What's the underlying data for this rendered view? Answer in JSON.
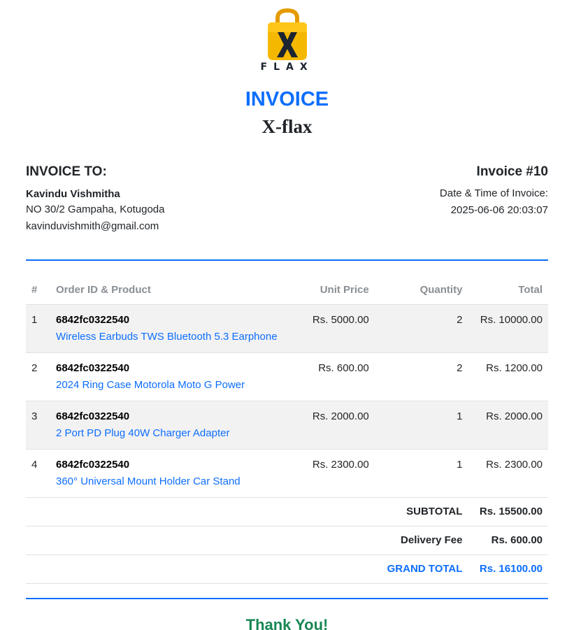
{
  "brand": {
    "logo_text": "FLAX",
    "title": "INVOICE",
    "company": "X-flax"
  },
  "bill_to": {
    "heading": "INVOICE TO:",
    "name": "Kavindu Vishmitha",
    "address": "NO 30/2 Gampaha, Kotugoda",
    "email": "kavinduvishmith@gmail.com"
  },
  "invoice": {
    "number": "Invoice #10",
    "date_label": "Date & Time of Invoice:",
    "datetime": "2025-06-06 20:03:07"
  },
  "table": {
    "headers": [
      "#",
      "Order ID & Product",
      "Unit Price",
      "Quantity",
      "Total"
    ],
    "rows": [
      {
        "n": "1",
        "order_id": "6842fc0322540",
        "product": "Wireless Earbuds TWS Bluetooth 5.3 Earphone",
        "unit_price": "Rs. 5000.00",
        "qty": "2",
        "total": "Rs. 10000.00"
      },
      {
        "n": "2",
        "order_id": "6842fc0322540",
        "product": "2024 Ring Case Motorola Moto G Power",
        "unit_price": "Rs. 600.00",
        "qty": "2",
        "total": "Rs. 1200.00"
      },
      {
        "n": "3",
        "order_id": "6842fc0322540",
        "product": "2 Port PD Plug 40W Charger Adapter",
        "unit_price": "Rs. 2000.00",
        "qty": "1",
        "total": "Rs. 2000.00"
      },
      {
        "n": "4",
        "order_id": "6842fc0322540",
        "product": "360° Universal Mount Holder Car Stand",
        "unit_price": "Rs. 2300.00",
        "qty": "1",
        "total": "Rs. 2300.00"
      }
    ]
  },
  "summary": {
    "subtotal_label": "SUBTOTAL",
    "subtotal": "Rs. 15500.00",
    "delivery_label": "Delivery Fee",
    "delivery": "Rs. 600.00",
    "grand_label": "GRAND TOTAL",
    "grand": "Rs. 16100.00"
  },
  "footer": {
    "thanks": "Thank You!"
  },
  "colors": {
    "accent": "#0d6efd",
    "success": "#198754",
    "logo_bag": "#f5b800"
  },
  "icons": {
    "logo": "shopping-bag-x-icon"
  }
}
